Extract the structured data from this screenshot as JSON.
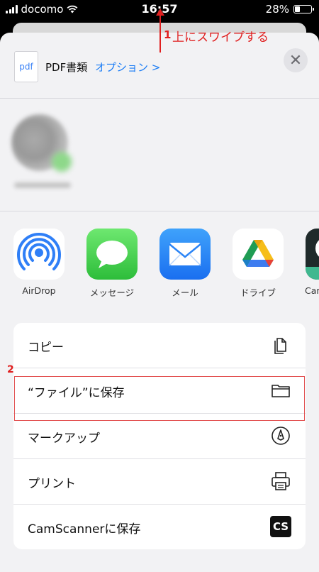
{
  "status_bar": {
    "carrier": "docomo",
    "time": "16:57",
    "battery": "28%"
  },
  "annotations": {
    "step1_number": "1",
    "step1_text": "上にスワイプする",
    "step2_number": "2"
  },
  "share_header": {
    "file_icon_text": "pdf",
    "document_name": "PDF書類",
    "options_label": "オプション >",
    "close_symbol": "✕"
  },
  "apps": [
    {
      "label": "AirDrop",
      "icon": "airdrop-icon"
    },
    {
      "label": "メッセージ",
      "icon": "messages-icon"
    },
    {
      "label": "メール",
      "icon": "mail-icon"
    },
    {
      "label": "ドライブ",
      "icon": "google-drive-icon"
    },
    {
      "label": "Cam",
      "icon": "camscanner-icon"
    }
  ],
  "actions": [
    {
      "label": "コピー",
      "icon": "copy-icon"
    },
    {
      "label": "“ファイル”に保存",
      "icon": "folder-icon"
    },
    {
      "label": "マークアップ",
      "icon": "markup-icon"
    },
    {
      "label": "プリント",
      "icon": "printer-icon"
    },
    {
      "label": "CamScannerに保存",
      "icon": "camscanner-logo-icon",
      "icon_text": "CS"
    }
  ],
  "colors": {
    "accent": "#1a7cf5",
    "annotation_red": "#e02020"
  }
}
